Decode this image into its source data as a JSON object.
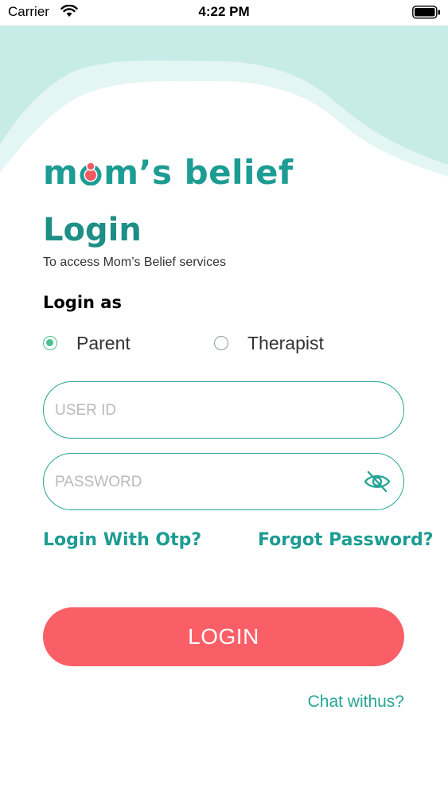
{
  "status_bar": {
    "carrier": "Carrier",
    "time": "4:22 PM"
  },
  "brand": {
    "logo_prefix": "m",
    "logo_suffix": "m’s belief",
    "logo_color": "#1d9c93",
    "logo_mark_color": "#f25a62"
  },
  "header": {
    "title": "Login",
    "subtitle": "To access Mom’s Belief services"
  },
  "login_as": {
    "label": "Login as",
    "options": [
      {
        "label": "Parent",
        "selected": true
      },
      {
        "label": "Therapist",
        "selected": false
      }
    ]
  },
  "form": {
    "user_id_placeholder": "USER ID",
    "user_id_value": "",
    "password_placeholder": "PASSWORD",
    "password_value": "",
    "password_toggle_icon": "eye-slash-icon"
  },
  "links": {
    "login_with_otp": "Login With Otp?",
    "forgot_password": "Forgot Password?"
  },
  "actions": {
    "login_label": "LOGIN",
    "chat_label": "Chat withus?"
  },
  "colors": {
    "accent": "#1d9c93",
    "field_border": "#26a596",
    "login_button": "#fa5f67",
    "radio_selected": "#4bbf8d",
    "wave_light": "#c7ece8"
  }
}
